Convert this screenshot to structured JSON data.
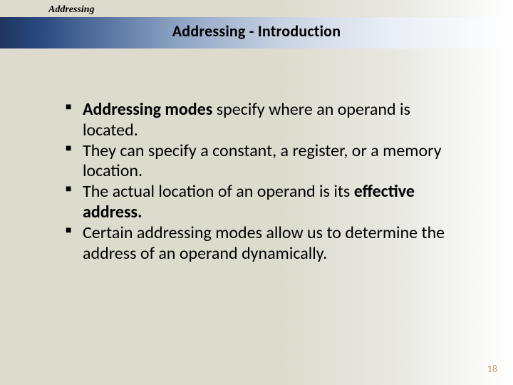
{
  "header": {
    "topic": "Addressing",
    "title": "Addressing - Introduction"
  },
  "bullets": {
    "b1a": "Addressing modes",
    "b1b": " specify where an operand is located.",
    "b2": "They can specify a constant, a register, or a memory location.",
    "b3a": "The actual location of an operand is its ",
    "b3b": "effective address.",
    "b4": "Certain addressing modes allow us to determine the address of an operand dynamically."
  },
  "footer": {
    "page": "18"
  }
}
